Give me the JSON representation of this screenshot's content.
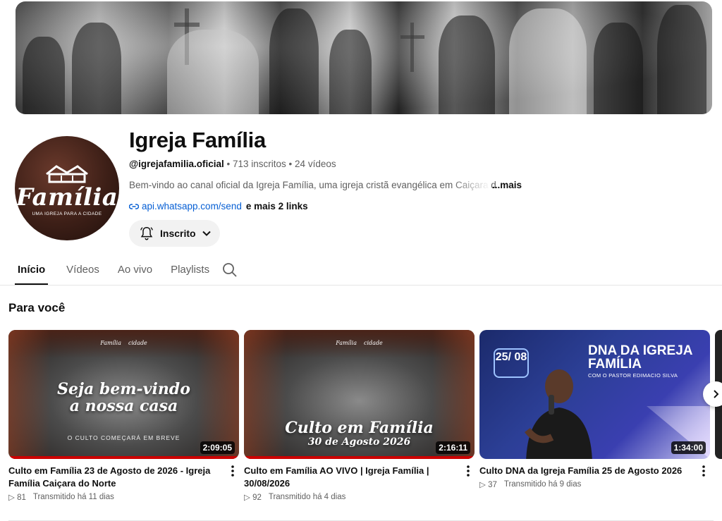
{
  "channel": {
    "name": "Igreja Família",
    "handle": "@igrejafamilia.oficial",
    "subscribers": "713 inscritos",
    "video_count": "24 vídeos",
    "separator": "•",
    "description": "Bem-vindo ao canal oficial da Igreja Família, uma igreja cristã evangélica em Caiçara do Norte",
    "more_label": "...mais",
    "link_text": "api.whatsapp.com/send",
    "more_links": "e mais 2 links",
    "subscribe_label": "Inscrito",
    "avatar_word": "Família",
    "avatar_tagline": "UMA IGREJA PARA A CIDADE"
  },
  "tabs": [
    {
      "label": "Início",
      "active": true
    },
    {
      "label": "Vídeos",
      "active": false
    },
    {
      "label": "Ao vivo",
      "active": false
    },
    {
      "label": "Playlists",
      "active": false
    }
  ],
  "section": {
    "title": "Para você"
  },
  "videos": [
    {
      "title": "Culto em Família 23 de Agosto de 2026 - Igreja Família Caiçara do Norte",
      "views": "81",
      "when": "Transmitido há 11 dias",
      "duration": "2:09:05",
      "thumb_text": "Seja bem-vindo a nossa casa",
      "thumb_sub": "O CULTO COMEÇARÁ EM BREVE"
    },
    {
      "title": "Culto em Família AO VIVO | Igreja Família | 30/08/2026",
      "views": "92",
      "when": "Transmitido há 4 dias",
      "duration": "2:16:11",
      "thumb_text": "Culto em Família",
      "thumb_sub": "30 de Agosto 2026"
    },
    {
      "title": "Culto DNA da Igreja Família 25 de Agosto 2026",
      "views": "37",
      "when": "Transmitido há 9 dias",
      "duration": "1:34:00",
      "thumb_date": "25/ 08",
      "thumb_title": "DNA DA IGREJA FAMÍLIA",
      "thumb_sub": "COM O PASTOR EDIMACIO SILVA"
    }
  ],
  "thumb_logo": {
    "left": "Família",
    "right": "cidade"
  },
  "colors": {
    "link": "#065fd4",
    "progress": "#cc0000",
    "brand_brown": "#3d1f17",
    "dna_blue": "#2c3f96"
  }
}
